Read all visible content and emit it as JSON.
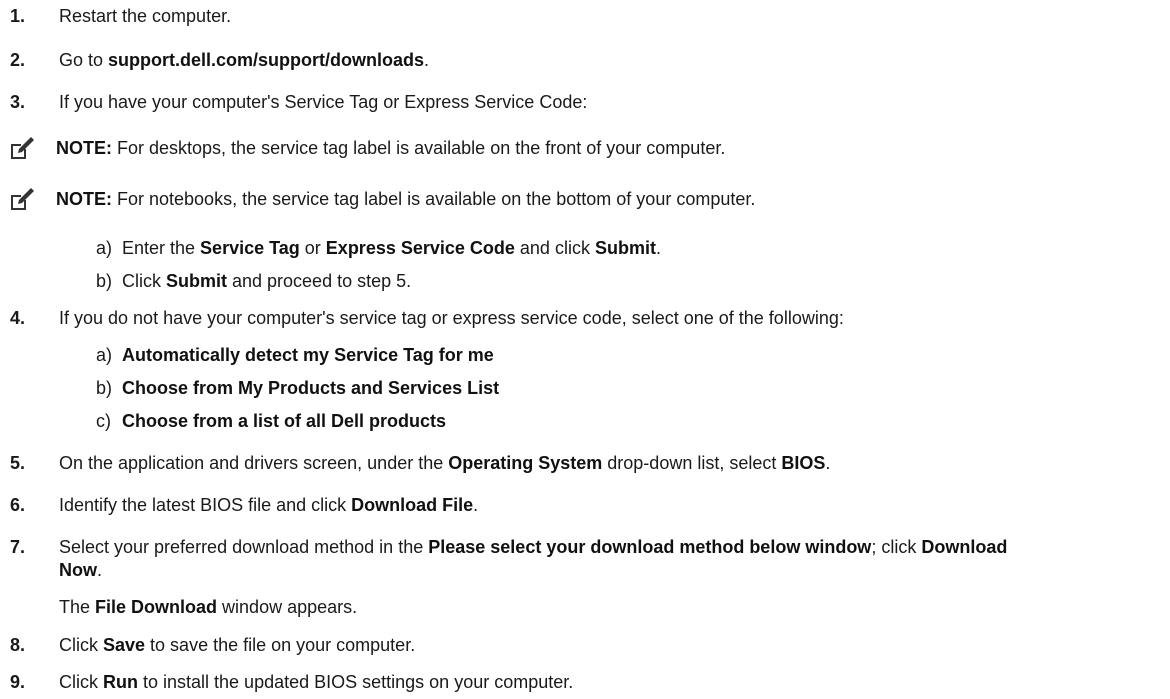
{
  "steps": {
    "s1": {
      "num": "1.",
      "text": "Restart the computer."
    },
    "s2": {
      "num": "2.",
      "pre": "Go to ",
      "b1": "support.dell.com/support/downloads",
      "post": "."
    },
    "s3": {
      "num": "3.",
      "text": "If you have your computer's Service Tag or Express Service Code:"
    },
    "note1": {
      "label": "NOTE:",
      "text": " For desktops, the service tag label is available on the front of your computer."
    },
    "note2": {
      "label": "NOTE:",
      "text": " For notebooks, the service tag label is available on the bottom of your computer."
    },
    "s3a": {
      "lbl": "a)",
      "t1": "Enter the ",
      "b1": "Service Tag",
      "t2": " or ",
      "b2": "Express Service Code",
      "t3": " and click ",
      "b3": "Submit",
      "t4": "."
    },
    "s3b": {
      "lbl": "b)",
      "t1": "Click ",
      "b1": "Submit",
      "t2": " and proceed to step 5."
    },
    "s4": {
      "num": "4.",
      "text": "If you do not have your computer's service tag or express service code, select one of the following:"
    },
    "s4a": {
      "lbl": "a)",
      "b1": "Automatically detect my Service Tag for me"
    },
    "s4b": {
      "lbl": "b)",
      "b1": "Choose from My Products and Services List"
    },
    "s4c": {
      "lbl": "c)",
      "b1": "Choose from a list of all Dell products"
    },
    "s5": {
      "num": "5.",
      "t1": "On the application and drivers screen, under the ",
      "b1": "Operating System",
      "t2": " drop-down list, select ",
      "b2": "BIOS",
      "t3": "."
    },
    "s6": {
      "num": "6.",
      "t1": "Identify the latest BIOS file and click ",
      "b1": "Download File",
      "t2": "."
    },
    "s7": {
      "num": "7.",
      "t1": "Select your preferred download method in the ",
      "b1": "Please select your download method below window",
      "t2": "; click ",
      "b2": "Download",
      "b3": "Now",
      "t3": "."
    },
    "s7c": {
      "t1": "The ",
      "b1": "File Download",
      "t2": " window appears."
    },
    "s8": {
      "num": "8.",
      "t1": "Click ",
      "b1": "Save",
      "t2": " to save the file on your computer."
    },
    "s9": {
      "num": "9.",
      "t1": "Click ",
      "b1": "Run",
      "t2": " to install the updated BIOS settings on your computer."
    }
  },
  "icons": {
    "note": "pencil-note-icon"
  }
}
